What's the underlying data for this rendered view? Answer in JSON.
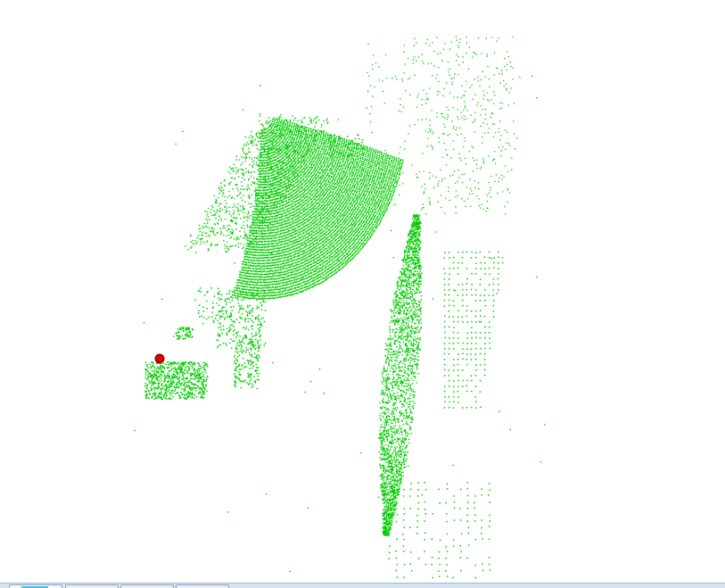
{
  "viewer": {
    "background_color": "#ffffff",
    "point_color": "#00cc00",
    "marker_color": "#dd0000",
    "marker_icon": "selected-point-marker"
  },
  "tabs": [
    {
      "label": "",
      "active": true,
      "accent_color": "#36c7e8"
    },
    {
      "label": "",
      "active": false
    },
    {
      "label": "",
      "active": false
    },
    {
      "label": "",
      "active": false
    }
  ]
}
